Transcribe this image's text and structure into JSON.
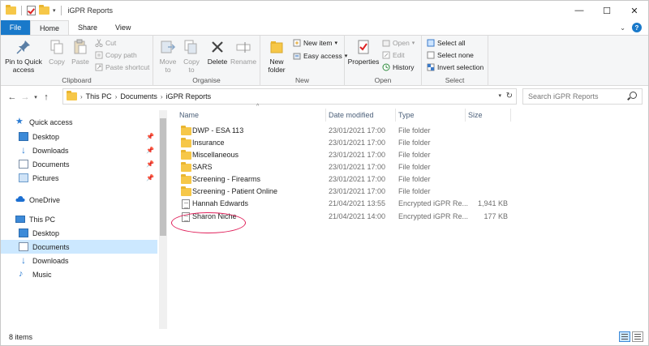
{
  "window": {
    "title": "iGPR Reports",
    "controls": [
      "—",
      "☐",
      "✕"
    ]
  },
  "tabs": [
    {
      "label": "File"
    },
    {
      "label": "Home"
    },
    {
      "label": "Share"
    },
    {
      "label": "View"
    }
  ],
  "ribbon": {
    "clipboard": {
      "label": "Clipboard",
      "pin": "Pin to Quick access",
      "copy": "Copy",
      "paste": "Paste",
      "cut": "Cut",
      "copy_path": "Copy path",
      "paste_shortcut": "Paste shortcut"
    },
    "organise": {
      "label": "Organise",
      "move_to": "Move to",
      "copy_to": "Copy to",
      "delete": "Delete",
      "rename": "Rename"
    },
    "new": {
      "label": "New",
      "new_folder": "New folder",
      "new_item": "New item",
      "easy_access": "Easy access"
    },
    "open": {
      "label": "Open",
      "properties": "Properties",
      "open": "Open",
      "edit": "Edit",
      "history": "History"
    },
    "select": {
      "label": "Select",
      "select_all": "Select all",
      "select_none": "Select none",
      "invert_selection": "Invert selection"
    }
  },
  "address": {
    "crumbs": [
      "This PC",
      "Documents",
      "iGPR Reports"
    ],
    "search_placeholder": "Search iGPR Reports"
  },
  "navpane": {
    "quick_access": "Quick access",
    "quick_items": [
      {
        "label": "Desktop",
        "pinned": true
      },
      {
        "label": "Downloads",
        "pinned": true
      },
      {
        "label": "Documents",
        "pinned": true
      },
      {
        "label": "Pictures",
        "pinned": true
      }
    ],
    "onedrive": "OneDrive",
    "this_pc": "This PC",
    "pc_items": [
      {
        "label": "Desktop"
      },
      {
        "label": "Documents"
      },
      {
        "label": "Downloads"
      },
      {
        "label": "Music"
      }
    ]
  },
  "columns": {
    "name": "Name",
    "date": "Date modified",
    "type": "Type",
    "size": "Size"
  },
  "files": [
    {
      "name": "DWP - ESA 113",
      "date": "23/01/2021 17:00",
      "type": "File folder",
      "size": "",
      "kind": "folder"
    },
    {
      "name": "Insurance",
      "date": "23/01/2021 17:00",
      "type": "File folder",
      "size": "",
      "kind": "folder"
    },
    {
      "name": "Miscellaneous",
      "date": "23/01/2021 17:00",
      "type": "File folder",
      "size": "",
      "kind": "folder"
    },
    {
      "name": "SARS",
      "date": "23/01/2021 17:00",
      "type": "File folder",
      "size": "",
      "kind": "folder"
    },
    {
      "name": "Screening - Firearms",
      "date": "23/01/2021 17:00",
      "type": "File folder",
      "size": "",
      "kind": "folder"
    },
    {
      "name": "Screening - Patient Online",
      "date": "23/01/2021 17:00",
      "type": "File folder",
      "size": "",
      "kind": "folder"
    },
    {
      "name": "Hannah Edwards",
      "date": "21/04/2021 13:55",
      "type": "Encrypted iGPR Re...",
      "size": "1,941 KB",
      "kind": "doc"
    },
    {
      "name": "Sharon Niche",
      "date": "21/04/2021 14:00",
      "type": "Encrypted iGPR Re...",
      "size": "177 KB",
      "kind": "doc"
    }
  ],
  "status": {
    "item_count": "8 items"
  },
  "colors": {
    "accent": "#1979ca",
    "folder": "#f6c748",
    "highlight_ring": "#e0205a",
    "selected_nav": "#cce8ff"
  }
}
